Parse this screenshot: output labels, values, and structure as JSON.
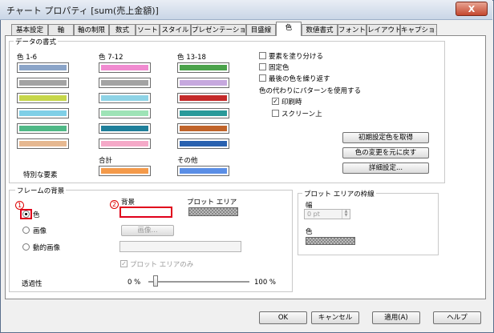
{
  "window": {
    "title": "チャート プロパティ [sum(売上金額)]",
    "close_glyph": "X"
  },
  "tabs": [
    "基本設定",
    "軸",
    "軸の制限",
    "数式",
    "ソート",
    "スタイル",
    "プレゼンテーション",
    "目盛線",
    "色",
    "数値書式",
    "フォント",
    "レイアウト",
    "キャプション"
  ],
  "active_tab": "色",
  "data_appearance": {
    "title": "データの書式",
    "col_labels": [
      "色 1-6",
      "色 7-12",
      "色 13-18"
    ],
    "col1": [
      "#8aa4c8",
      "#a3a3a3",
      "#c6d64a",
      "#7fcfe6",
      "#4fb886",
      "#e6b890"
    ],
    "col2": [
      "#f08ad0",
      "#a3a3a3",
      "#8ed3e6",
      "#9ee3b6",
      "#1f7f9a",
      "#f5a9c8"
    ],
    "col3": [
      "#4aa24a",
      "#c6a8de",
      "#c42a2a",
      "#2a9a9a",
      "#c0642a",
      "#2a62b0"
    ],
    "total_label": "合計",
    "total_color": "#f49a4a",
    "other_label": "その他",
    "other_color": "#5a8ee6",
    "special_label": "特別な要素",
    "checkboxes": [
      {
        "label": "要素を塗り分ける",
        "checked": false
      },
      {
        "label": "固定色",
        "checked": false
      },
      {
        "label": "最後の色を繰り返す",
        "checked": false
      }
    ],
    "pattern_label": "色の代わりにパターンを使用する",
    "pattern_options": [
      {
        "label": "印刷時",
        "checked": true
      },
      {
        "label": "スクリーン上",
        "checked": false
      }
    ],
    "buttons": [
      "初期設定色を取得",
      "色の変更を元に戻す",
      "詳細設定..."
    ]
  },
  "frame_background": {
    "title": "フレームの背景",
    "radios": [
      {
        "label": "色",
        "selected": true
      },
      {
        "label": "画像",
        "selected": false
      },
      {
        "label": "動的画像",
        "selected": false
      }
    ],
    "bg_label": "背景",
    "plot_label": "プロット エリア",
    "image_button": "画像...",
    "plot_area_only": "プロット エリアのみ",
    "transparency_label": "透過性",
    "transparency_min": "0 %",
    "transparency_max": "100 %",
    "transparency_value": 0,
    "annotation_1": "1",
    "annotation_2": "2"
  },
  "plot_area_border": {
    "title": "プロット エリアの枠線",
    "width_label": "幅",
    "width_value": "0 pt",
    "color_label": "色"
  },
  "footer": {
    "ok": "OK",
    "cancel": "キャンセル",
    "apply": "適用(A)",
    "help": "ヘルプ"
  }
}
